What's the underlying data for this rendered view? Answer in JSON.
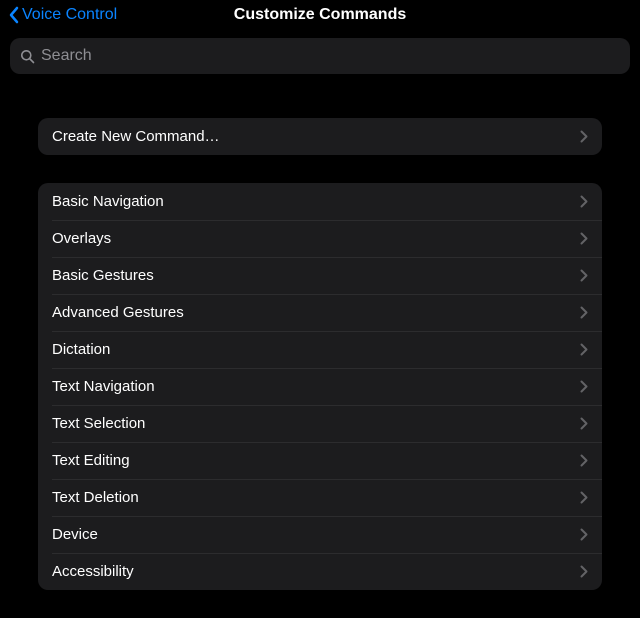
{
  "nav": {
    "back_label": "Voice Control",
    "title": "Customize Commands"
  },
  "search": {
    "placeholder": "Search",
    "value": ""
  },
  "create_row": {
    "label": "Create New Command…"
  },
  "categories": [
    {
      "label": "Basic Navigation"
    },
    {
      "label": "Overlays"
    },
    {
      "label": "Basic Gestures"
    },
    {
      "label": "Advanced Gestures"
    },
    {
      "label": "Dictation"
    },
    {
      "label": "Text Navigation"
    },
    {
      "label": "Text Selection"
    },
    {
      "label": "Text Editing"
    },
    {
      "label": "Text Deletion"
    },
    {
      "label": "Device"
    },
    {
      "label": "Accessibility"
    }
  ],
  "colors": {
    "accent": "#0a84ff",
    "row_bg": "#1c1c1e",
    "separator": "#2c2c2e",
    "secondary_text": "#8e8e93"
  }
}
